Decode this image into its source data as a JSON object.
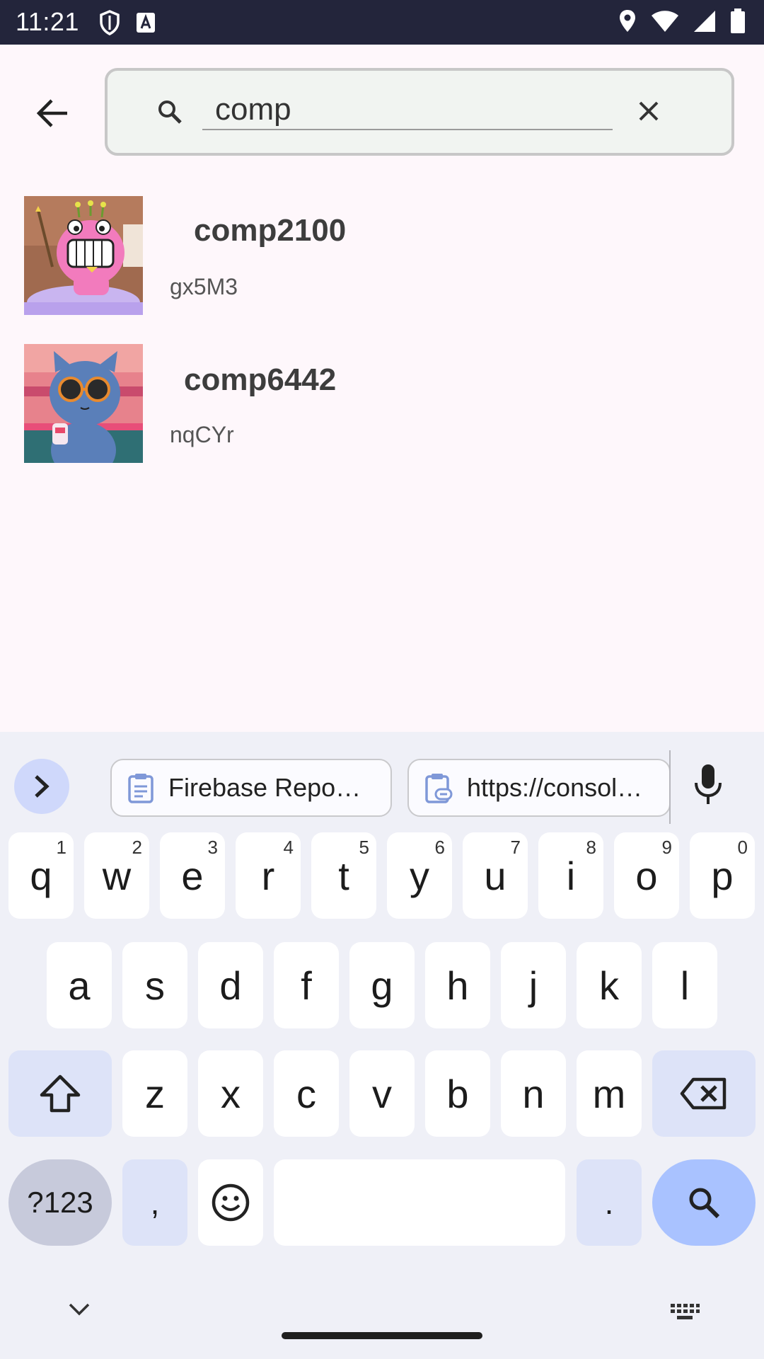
{
  "status_bar": {
    "time": "11:21",
    "icons": [
      "shield-icon",
      "text-a-icon",
      "location-icon",
      "wifi-icon",
      "signal-icon",
      "battery-icon"
    ]
  },
  "search": {
    "query": "comp",
    "back_icon": "arrow-back-icon",
    "search_icon": "search-icon",
    "clear_icon": "close-icon"
  },
  "results": [
    {
      "title": "comp2100",
      "subtitle": "gx5M3",
      "thumbnail": "pink-monster-avatar"
    },
    {
      "title": "comp6442",
      "subtitle": "nqCYr",
      "thumbnail": "blue-cat-sunglasses-avatar"
    }
  ],
  "keyboard": {
    "suggestions": [
      {
        "label": "Firebase Repo…",
        "icon": "clipboard-icon"
      },
      {
        "label": "https://consol…",
        "icon": "clipboard-link-icon"
      }
    ],
    "row1": [
      {
        "key": "q",
        "hint": "1"
      },
      {
        "key": "w",
        "hint": "2"
      },
      {
        "key": "e",
        "hint": "3"
      },
      {
        "key": "r",
        "hint": "4"
      },
      {
        "key": "t",
        "hint": "5"
      },
      {
        "key": "y",
        "hint": "6"
      },
      {
        "key": "u",
        "hint": "7"
      },
      {
        "key": "i",
        "hint": "8"
      },
      {
        "key": "o",
        "hint": "9"
      },
      {
        "key": "p",
        "hint": "0"
      }
    ],
    "row2": [
      "a",
      "s",
      "d",
      "f",
      "g",
      "h",
      "j",
      "k",
      "l"
    ],
    "row3": [
      "z",
      "x",
      "c",
      "v",
      "b",
      "n",
      "m"
    ],
    "symbols_label": "?123",
    "comma_label": ",",
    "period_label": ".",
    "colors": {
      "accent": "#a9c2ff",
      "modifier": "#dde3f8",
      "key": "#ffffff",
      "background": "#eff0f7"
    }
  }
}
